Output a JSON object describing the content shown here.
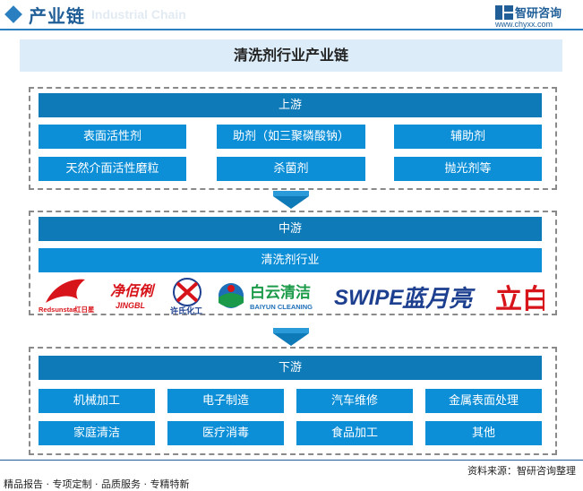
{
  "header": {
    "title": "产业链",
    "subtitle": "Industrial Chain",
    "brand_name": "智研咨询",
    "brand_url": "www.chyxx.com"
  },
  "main_title": "清洗剂行业产业链",
  "upstream": {
    "label": "上游",
    "items": [
      "表面活性剂",
      "助剂（如三聚磷酸钠）",
      "辅助剂",
      "天然介面活性磨粒",
      "杀菌剂",
      "抛光剂等"
    ]
  },
  "midstream": {
    "label": "中游",
    "industry": "清洗剂行业",
    "logos": [
      {
        "name": "Redsunstar 红日星",
        "text": "Redsunstar",
        "cn": "红日星"
      },
      {
        "name": "净佰俐 JINGBL",
        "text": "净佰俐",
        "en": "JINGBL"
      },
      {
        "name": "许氏化工",
        "text": "许氏化工"
      },
      {
        "name": "白云清洁 BAIYUN CLEANING",
        "text": "白云清洁",
        "en": "BAIYUN CLEANING"
      },
      {
        "name": "SWIPE 蓝月亮",
        "text": "SWIPE",
        "cn": "蓝月亮"
      },
      {
        "name": "立白",
        "text": "立白"
      }
    ]
  },
  "downstream": {
    "label": "下游",
    "items": [
      "机械加工",
      "电子制造",
      "汽车维修",
      "金属表面处理",
      "家庭清洁",
      "医疗消毒",
      "食品加工",
      "其他"
    ]
  },
  "footer": {
    "left": "精品报告 · 专项定制 · 品质服务 · 专精特新",
    "right": "资料来源：智研咨询整理"
  },
  "colors": {
    "primary": "#0d8fd8",
    "dark": "#0f7ab8",
    "title_bg": "#dcecf8",
    "brand": "#1f5e97"
  }
}
